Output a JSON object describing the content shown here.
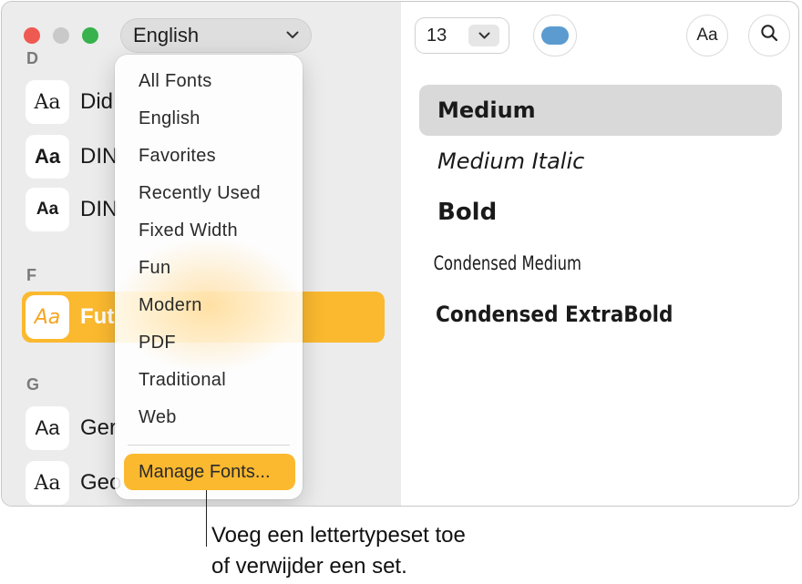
{
  "toolbar": {
    "collection": "English",
    "size": "13",
    "font_preview_button": "Aa"
  },
  "sidebar": {
    "sections": [
      {
        "letter": "D",
        "fonts": [
          {
            "sample": "Aa",
            "name": "Did"
          },
          {
            "sample": "Aa",
            "name": "DIN"
          },
          {
            "sample": "Aa",
            "name": "DIN"
          }
        ]
      },
      {
        "letter": "F",
        "fonts": [
          {
            "sample": "Aa",
            "name": "Fut",
            "selected": true
          }
        ]
      },
      {
        "letter": "G",
        "fonts": [
          {
            "sample": "Aa",
            "name": "Ger"
          },
          {
            "sample": "Aa",
            "name": "Geo"
          }
        ]
      }
    ]
  },
  "menu": {
    "items": [
      "All Fonts",
      "English",
      "Favorites",
      "Recently Used",
      "Fixed Width",
      "Fun",
      "Modern",
      "PDF",
      "Traditional",
      "Web"
    ],
    "manage": "Manage Fonts..."
  },
  "styles": [
    "Medium",
    "Medium Italic",
    "Bold",
    "Condensed Medium",
    "Condensed ExtraBold"
  ],
  "selected_style": "Medium",
  "callout": {
    "line1": "Voeg een lettertypeset toe",
    "line2": "of verwijder een set."
  },
  "colors": {
    "accent": "#fbb92f",
    "color_well": "#5b9bd0"
  }
}
